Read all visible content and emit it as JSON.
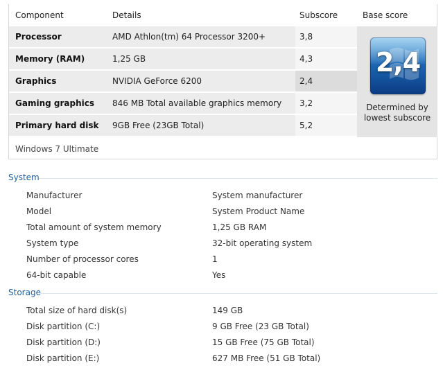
{
  "table": {
    "headers": {
      "component": "Component",
      "details": "Details",
      "subscore": "Subscore",
      "base_score": "Base score"
    },
    "rows": [
      {
        "component": "Processor",
        "details": "AMD Athlon(tm) 64 Processor 3200+",
        "subscore": "3,8"
      },
      {
        "component": "Memory (RAM)",
        "details": "1,25 GB",
        "subscore": "4,3"
      },
      {
        "component": "Graphics",
        "details": "NVIDIA GeForce 6200",
        "subscore": "2,4"
      },
      {
        "component": "Gaming graphics",
        "details": "846 MB Total available graphics memory",
        "subscore": "3,2"
      },
      {
        "component": "Primary hard disk",
        "details": "9GB Free (23GB Total)",
        "subscore": "5,2"
      }
    ],
    "base_score": {
      "value": "2,4",
      "caption_line1": "Determined by",
      "caption_line2": "lowest subscore"
    },
    "edition": "Windows 7 Ultimate"
  },
  "system": {
    "title": "System",
    "items": [
      {
        "key": "Manufacturer",
        "value": "System manufacturer"
      },
      {
        "key": "Model",
        "value": "System Product Name"
      },
      {
        "key": "Total amount of system memory",
        "value": "1,25 GB RAM"
      },
      {
        "key": "System type",
        "value": "32-bit operating system"
      },
      {
        "key": "Number of processor cores",
        "value": "1"
      },
      {
        "key": "64-bit capable",
        "value": "Yes"
      }
    ]
  },
  "storage": {
    "title": "Storage",
    "items": [
      {
        "key": "Total size of hard disk(s)",
        "value": "149 GB"
      },
      {
        "key": "Disk partition (C:)",
        "value": "9 GB Free (23 GB Total)"
      },
      {
        "key": "Disk partition (D:)",
        "value": "15 GB Free (75 GB Total)"
      },
      {
        "key": "Disk partition (E:)",
        "value": "627 MB Free (51 GB Total)"
      }
    ]
  }
}
